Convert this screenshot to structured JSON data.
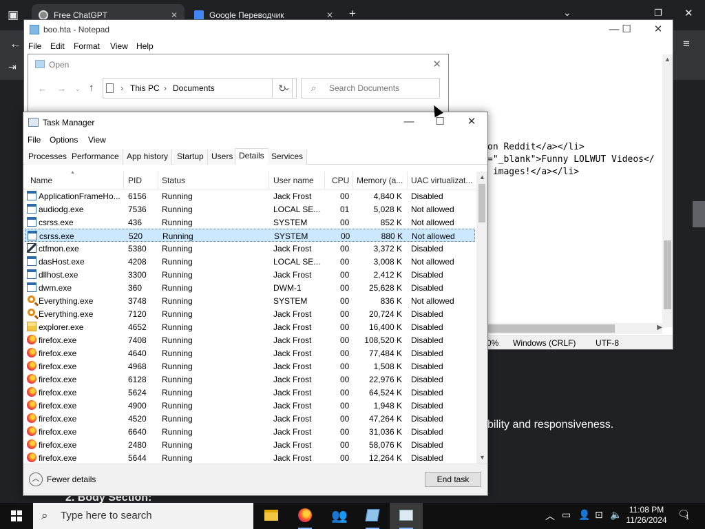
{
  "browser": {
    "tabs": [
      {
        "label": "Free ChatGPT",
        "active": true
      },
      {
        "label": "Google Переводчик",
        "active": false
      }
    ],
    "page_text": {
      "fragment": "bility and responsiveness.",
      "heading": "2. Body Section:"
    }
  },
  "notepad": {
    "title": "boo.hta - Notepad",
    "menu": [
      "File",
      "Edit",
      "Format",
      "View",
      "Help"
    ],
    "code_lines": [
      "on Reddit</a></li>",
      "=\"_blank\">Funny LOLWUT Videos</",
      " images!</a></li>"
    ],
    "status": {
      "zoom": "0%",
      "line_ending": "Windows (CRLF)",
      "encoding": "UTF-8"
    }
  },
  "open_dialog": {
    "title": "Open",
    "path": [
      "This PC",
      "Documents"
    ],
    "search_placeholder": "Search Documents"
  },
  "task_manager": {
    "title": "Task Manager",
    "menu": [
      "File",
      "Options",
      "View"
    ],
    "tabs": [
      "Processes",
      "Performance",
      "App history",
      "Startup",
      "Users",
      "Details",
      "Services"
    ],
    "active_tab": "Details",
    "columns": [
      "Name",
      "PID",
      "Status",
      "User name",
      "CPU",
      "Memory (a...",
      "UAC virtualizat..."
    ],
    "rows": [
      {
        "icon": "app-window-icon",
        "name": "ApplicationFrameHo...",
        "pid": "6156",
        "status": "Running",
        "user": "Jack Frost",
        "cpu": "00",
        "mem": "4,840 K",
        "uac": "Disabled"
      },
      {
        "icon": "app-window-icon",
        "name": "audiodg.exe",
        "pid": "7536",
        "status": "Running",
        "user": "LOCAL SE...",
        "cpu": "01",
        "mem": "5,028 K",
        "uac": "Not allowed"
      },
      {
        "icon": "app-window-icon",
        "name": "csrss.exe",
        "pid": "436",
        "status": "Running",
        "user": "SYSTEM",
        "cpu": "00",
        "mem": "852 K",
        "uac": "Not allowed"
      },
      {
        "icon": "app-window-icon",
        "name": "csrss.exe",
        "pid": "520",
        "status": "Running",
        "user": "SYSTEM",
        "cpu": "00",
        "mem": "880 K",
        "uac": "Not allowed",
        "selected": true
      },
      {
        "icon": "ctfmon-pen-icon",
        "name": "ctfmon.exe",
        "pid": "5380",
        "status": "Running",
        "user": "Jack Frost",
        "cpu": "00",
        "mem": "3,372 K",
        "uac": "Disabled"
      },
      {
        "icon": "app-window-icon",
        "name": "dasHost.exe",
        "pid": "4208",
        "status": "Running",
        "user": "LOCAL SE...",
        "cpu": "00",
        "mem": "3,008 K",
        "uac": "Not allowed"
      },
      {
        "icon": "app-window-icon",
        "name": "dllhost.exe",
        "pid": "3300",
        "status": "Running",
        "user": "Jack Frost",
        "cpu": "00",
        "mem": "2,412 K",
        "uac": "Disabled"
      },
      {
        "icon": "app-window-icon",
        "name": "dwm.exe",
        "pid": "360",
        "status": "Running",
        "user": "DWM-1",
        "cpu": "00",
        "mem": "25,628 K",
        "uac": "Disabled"
      },
      {
        "icon": "everything-magnifier-icon",
        "name": "Everything.exe",
        "pid": "3748",
        "status": "Running",
        "user": "SYSTEM",
        "cpu": "00",
        "mem": "836 K",
        "uac": "Not allowed"
      },
      {
        "icon": "everything-magnifier-icon",
        "name": "Everything.exe",
        "pid": "7120",
        "status": "Running",
        "user": "Jack Frost",
        "cpu": "00",
        "mem": "20,724 K",
        "uac": "Disabled"
      },
      {
        "icon": "explorer-folder-icon",
        "name": "explorer.exe",
        "pid": "4652",
        "status": "Running",
        "user": "Jack Frost",
        "cpu": "00",
        "mem": "16,400 K",
        "uac": "Disabled"
      },
      {
        "icon": "firefox-icon",
        "name": "firefox.exe",
        "pid": "7408",
        "status": "Running",
        "user": "Jack Frost",
        "cpu": "00",
        "mem": "108,520 K",
        "uac": "Disabled"
      },
      {
        "icon": "firefox-icon",
        "name": "firefox.exe",
        "pid": "4640",
        "status": "Running",
        "user": "Jack Frost",
        "cpu": "00",
        "mem": "77,484 K",
        "uac": "Disabled"
      },
      {
        "icon": "firefox-icon",
        "name": "firefox.exe",
        "pid": "4968",
        "status": "Running",
        "user": "Jack Frost",
        "cpu": "00",
        "mem": "1,508 K",
        "uac": "Disabled"
      },
      {
        "icon": "firefox-icon",
        "name": "firefox.exe",
        "pid": "6128",
        "status": "Running",
        "user": "Jack Frost",
        "cpu": "00",
        "mem": "22,976 K",
        "uac": "Disabled"
      },
      {
        "icon": "firefox-icon",
        "name": "firefox.exe",
        "pid": "5624",
        "status": "Running",
        "user": "Jack Frost",
        "cpu": "00",
        "mem": "64,524 K",
        "uac": "Disabled"
      },
      {
        "icon": "firefox-icon",
        "name": "firefox.exe",
        "pid": "4900",
        "status": "Running",
        "user": "Jack Frost",
        "cpu": "00",
        "mem": "1,948 K",
        "uac": "Disabled"
      },
      {
        "icon": "firefox-icon",
        "name": "firefox.exe",
        "pid": "4520",
        "status": "Running",
        "user": "Jack Frost",
        "cpu": "00",
        "mem": "47,264 K",
        "uac": "Disabled"
      },
      {
        "icon": "firefox-icon",
        "name": "firefox.exe",
        "pid": "6640",
        "status": "Running",
        "user": "Jack Frost",
        "cpu": "00",
        "mem": "31,036 K",
        "uac": "Disabled"
      },
      {
        "icon": "firefox-icon",
        "name": "firefox.exe",
        "pid": "2480",
        "status": "Running",
        "user": "Jack Frost",
        "cpu": "00",
        "mem": "58,076 K",
        "uac": "Disabled"
      },
      {
        "icon": "firefox-icon",
        "name": "firefox.exe",
        "pid": "5644",
        "status": "Running",
        "user": "Jack Frost",
        "cpu": "00",
        "mem": "12,264 K",
        "uac": "Disabled"
      }
    ],
    "footer": {
      "fewer_details": "Fewer details",
      "end_task": "End task"
    }
  },
  "taskbar": {
    "search_placeholder": "Type here to search",
    "time": "11:08 PM",
    "date": "11/26/2024",
    "notification_count": "1"
  }
}
